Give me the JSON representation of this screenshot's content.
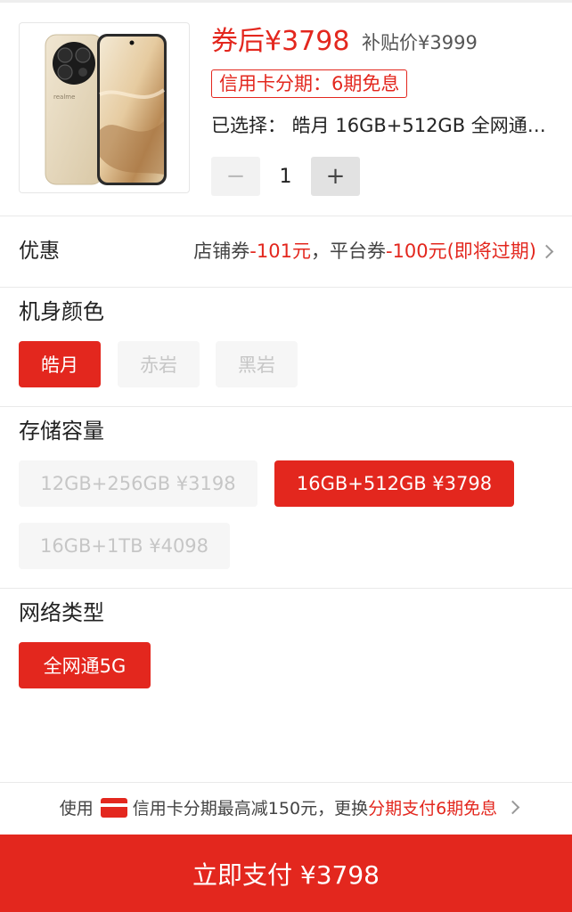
{
  "product": {
    "coupon_price": "券后¥3798",
    "subsidy_price": "补贴价¥3999",
    "installment_tag": "信用卡分期：6期免息",
    "selected_text": "已选择：  皓月 16GB+512GB 全网通…",
    "quantity": "1",
    "minus_label": "−",
    "plus_label": "+"
  },
  "promotions": {
    "label": "优惠",
    "shop_coupon_label": "店铺券",
    "shop_coupon_value": "-101元",
    "separator": "，",
    "platform_coupon_label": "平台券",
    "platform_coupon_value": "-100元(即将过期)"
  },
  "color": {
    "title": "机身颜色",
    "options": [
      "皓月",
      "赤岩",
      "黑岩"
    ],
    "selected": "皓月"
  },
  "storage": {
    "title": "存储容量",
    "options": [
      "12GB+256GB ¥3198",
      "16GB+512GB ¥3798",
      "16GB+1TB ¥4098"
    ],
    "selected": "16GB+512GB ¥3798"
  },
  "network": {
    "title": "网络类型",
    "options": [
      "全网通5G"
    ],
    "selected": "全网通5G"
  },
  "footer": {
    "tip_prefix": "使用",
    "tip_mid": "信用卡分期最高减150元，更换",
    "tip_highlight": "分期支付6期免息",
    "pay_button": "立即支付 ¥3798"
  },
  "colors": {
    "accent": "#e3271e",
    "phone_body": "#e9dcc2",
    "camera": "#1b1b1b"
  }
}
